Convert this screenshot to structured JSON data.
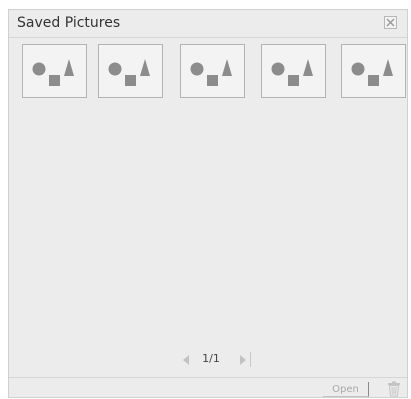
{
  "dialog": {
    "title": "Saved Pictures",
    "close_icon": "close-icon"
  },
  "thumbnails": [
    {
      "icon": "picture-placeholder-icon"
    },
    {
      "icon": "picture-placeholder-icon"
    },
    {
      "icon": "picture-placeholder-icon"
    },
    {
      "icon": "picture-placeholder-icon"
    },
    {
      "icon": "picture-placeholder-icon"
    }
  ],
  "pager": {
    "label": "1/1",
    "prev_icon": "triangle-left-icon",
    "next_icon": "triangle-right-icon"
  },
  "footer": {
    "open_label": "Open",
    "delete_icon": "trash-icon"
  },
  "colors": {
    "panel": "#ececec",
    "shape": "#8c8c8c",
    "thumb_border": "#b3b3b3"
  }
}
